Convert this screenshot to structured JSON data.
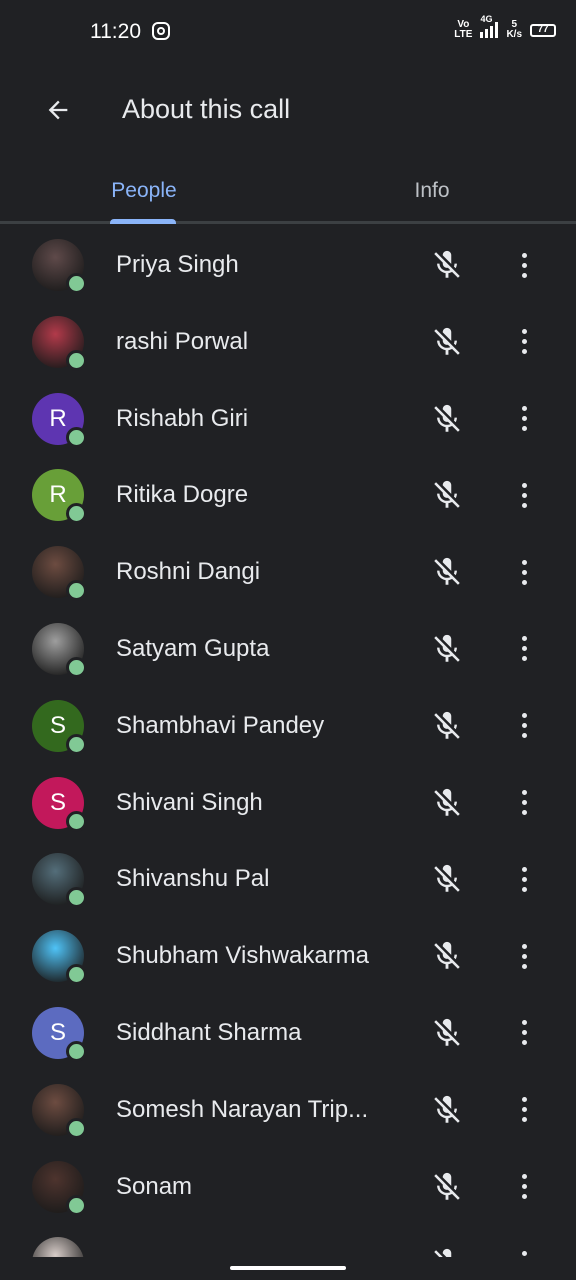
{
  "status_bar": {
    "time": "11:20",
    "volte_top": "Vo",
    "volte_bottom": "LTE",
    "network": "4G",
    "speed_value": "5",
    "speed_unit": "K/s",
    "battery": "77"
  },
  "header": {
    "title": "About this call"
  },
  "tabs": [
    {
      "label": "People",
      "active": true
    },
    {
      "label": "Info",
      "active": false
    }
  ],
  "participants": [
    {
      "name": "Priya Singh",
      "avatar": "photo",
      "initial": "",
      "color": "#5f4a4a",
      "muted": true
    },
    {
      "name": "rashi Porwal",
      "avatar": "photo",
      "initial": "",
      "color": "#b23a4a",
      "muted": true
    },
    {
      "name": "Rishabh Giri",
      "avatar": "letter",
      "initial": "R",
      "color": "#5e35b1",
      "muted": true
    },
    {
      "name": "Ritika Dogre",
      "avatar": "letter",
      "initial": "R",
      "color": "#689f38",
      "muted": true
    },
    {
      "name": "Roshni Dangi",
      "avatar": "photo",
      "initial": "",
      "color": "#6d4c41",
      "muted": true
    },
    {
      "name": "Satyam Gupta",
      "avatar": "photo",
      "initial": "",
      "color": "#9e9e9e",
      "muted": true
    },
    {
      "name": "Shambhavi Pandey",
      "avatar": "letter",
      "initial": "S",
      "color": "#33691e",
      "muted": true
    },
    {
      "name": "Shivani Singh",
      "avatar": "letter",
      "initial": "S",
      "color": "#c2185b",
      "muted": true
    },
    {
      "name": "Shivanshu Pal",
      "avatar": "photo",
      "initial": "",
      "color": "#546e7a",
      "muted": true
    },
    {
      "name": "Shubham Vishwakarma",
      "avatar": "photo",
      "initial": "",
      "color": "#4fc3f7",
      "muted": true
    },
    {
      "name": "Siddhant Sharma",
      "avatar": "letter",
      "initial": "S",
      "color": "#5c6bc0",
      "muted": true
    },
    {
      "name": "Somesh Narayan Trip...",
      "avatar": "photo",
      "initial": "",
      "color": "#6d4c41",
      "muted": true
    },
    {
      "name": "Sonam",
      "avatar": "photo",
      "initial": "",
      "color": "#4e342e",
      "muted": true
    },
    {
      "name": "",
      "avatar": "photo",
      "initial": "",
      "color": "#d7ccc8",
      "muted": true
    }
  ],
  "colors": {
    "background": "#202124",
    "accent": "#8ab4f8",
    "presence": "#81c995",
    "divider": "#3c4043"
  },
  "icons": {
    "back": "arrow-left-icon",
    "mic_off": "mic-off-icon",
    "more": "more-vert-icon"
  }
}
